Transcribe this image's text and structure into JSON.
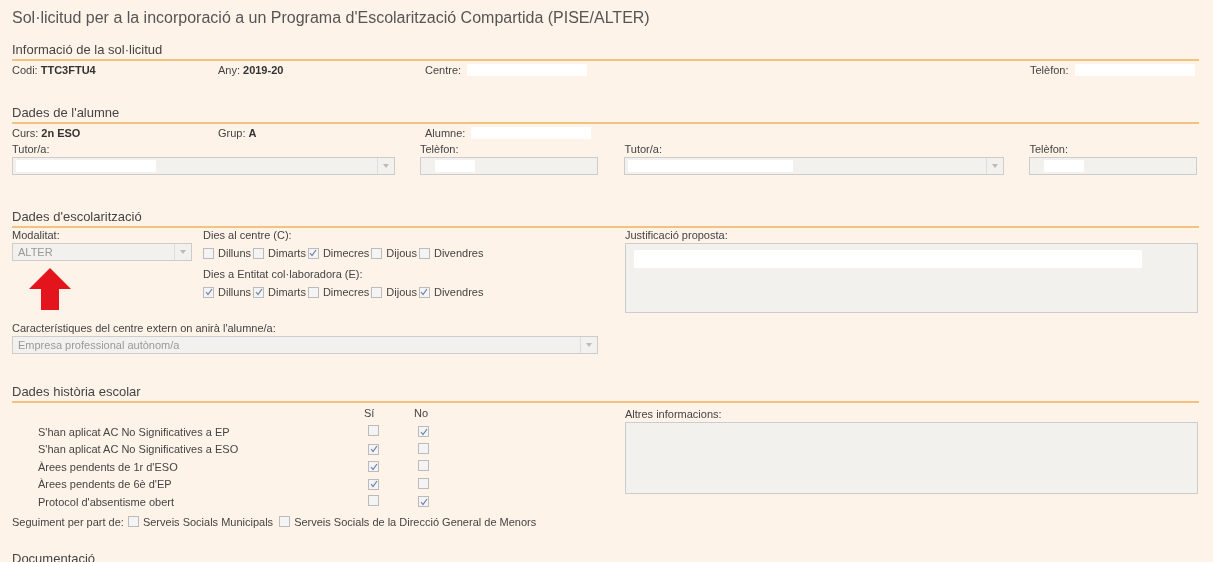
{
  "title": "Sol·licitud per a la incorporació a un Programa d'Escolarització Compartida (PISE/ALTER)",
  "request_info": {
    "heading": "Informació de la sol·licitud",
    "fields": [
      {
        "label": "Codi:",
        "value": "TTC3FTU4"
      },
      {
        "label": "Any:",
        "value": "2019-20"
      },
      {
        "label": "Centre:",
        "redacted": true
      },
      {
        "label": "Telèfon:",
        "redacted": true
      }
    ]
  },
  "student": {
    "heading": "Dades de l'alumne",
    "fields": [
      {
        "label": "Curs:",
        "value": "2n ESO"
      },
      {
        "label": "Grup:",
        "value": "A"
      },
      {
        "label": "Alumne:",
        "redacted": true
      }
    ],
    "tutors": [
      {
        "tutor_label": "Tutor/a:",
        "phone_label": "Telèfon:",
        "redacted": true
      },
      {
        "tutor_label": "Tutor/a:",
        "phone_label": "Telèfon:",
        "redacted": true
      }
    ]
  },
  "schooling": {
    "heading": "Dades d'escolarització",
    "modality": {
      "label": "Modalitat:",
      "value": "ALTER"
    },
    "day_groups": [
      {
        "label": "Dies al centre (C):",
        "days": [
          {
            "label": "Dilluns",
            "checked": false
          },
          {
            "label": "Dimarts",
            "checked": false
          },
          {
            "label": "Dimecres",
            "checked": true
          },
          {
            "label": "Dijous",
            "checked": false
          },
          {
            "label": "Divendres",
            "checked": false
          }
        ]
      },
      {
        "label": "Dies a Entitat col·laboradora (E):",
        "days": [
          {
            "label": "Dilluns",
            "checked": true
          },
          {
            "label": "Dimarts",
            "checked": true
          },
          {
            "label": "Dimecres",
            "checked": false
          },
          {
            "label": "Dijous",
            "checked": false
          },
          {
            "label": "Divendres",
            "checked": true
          }
        ]
      }
    ],
    "justification": {
      "label": "Justificació proposta:",
      "redacted": true
    },
    "external_centre": {
      "label": "Característiques del centre extern on anirà l'alumne/a:",
      "value": "Empresa professional autònom/a"
    }
  },
  "history": {
    "heading": "Dades història escolar",
    "columns": [
      "Sí",
      "No"
    ],
    "rows": [
      {
        "label": "S'han aplicat AC No Significatives a EP",
        "yes": false,
        "no": true
      },
      {
        "label": "S'han aplicat AC No Significatives a ESO",
        "yes": true,
        "no": false
      },
      {
        "label": "Àrees pendents de 1r d'ESO",
        "yes": true,
        "no": false
      },
      {
        "label": "Àrees pendents de 6è d'EP",
        "yes": true,
        "no": false
      },
      {
        "label": "Protocol d'absentisme obert",
        "yes": false,
        "no": true
      }
    ],
    "other_info": {
      "label": "Altres informacions:"
    },
    "follow_up": {
      "label": "Seguiment per part de:",
      "options": [
        {
          "label": "Serveis Socials Municipals",
          "checked": false
        },
        {
          "label": "Serveis Socials de la Direcció General de Menors",
          "checked": false
        }
      ]
    }
  },
  "next_heading": "Documentació"
}
